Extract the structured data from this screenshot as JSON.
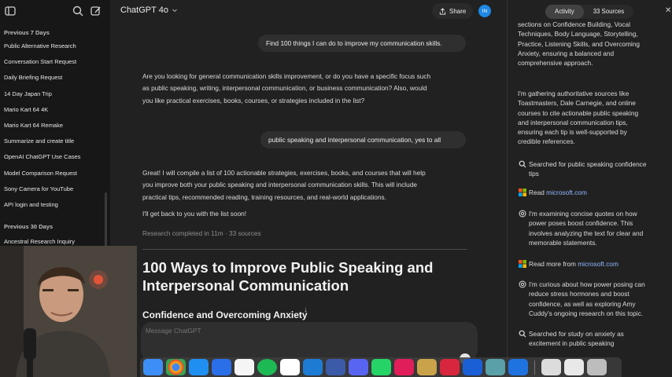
{
  "header": {
    "model_title": "ChatGPT 4o",
    "share_label": "Share",
    "avatar_initials": "IN"
  },
  "sidebar": {
    "sections": [
      {
        "label": "Previous 7 Days",
        "items": [
          "Public Alternative Research",
          "Conversation Start Request",
          "Daily Briefing Request",
          "14 Day Japan Trip",
          "Mario Kart 64 4K",
          "Mario Kart 64 Remake",
          "Summarize and create title",
          "OpenAI ChatGPT Use Cases",
          "Model Comparison Request",
          "Sony Camera for YouTube",
          "API login and testing"
        ]
      },
      {
        "label": "Previous 30 Days",
        "items": [
          "Ancestral Research Inquiry"
        ]
      }
    ]
  },
  "chat": {
    "user_msg_1": "Find 100 things I can do to improve my communication skills.",
    "assistant_msg_1": [
      "Are you looking for general communication skills improvement, or do you have a specific focus such",
      "as public speaking, writing, interpersonal communication, or business communication? Also, would",
      "you like practical exercises, books, courses, or strategies included in the list?"
    ],
    "user_msg_2": "public speaking and interpersonal communication, yes to all",
    "assistant_msg_2": [
      "Great! I will compile a list of 100 actionable strategies, exercises, books, and courses that will help",
      "you improve both your public speaking and interpersonal communication skills. This will include",
      "practical tips, recommended reading, training resources, and real-world applications."
    ],
    "assistant_msg_3": "I'll get back to you with the list soon!",
    "research_status": "Research completed in 11m · 33 sources",
    "report_title": "100 Ways to Improve Public Speaking and Interpersonal Communication",
    "report_subtitle": "Confidence and Overcoming Anxiety",
    "composer_placeholder": "Message ChatGPT"
  },
  "activity_panel": {
    "tab_activity": "Activity",
    "tab_sources": "33 Sources",
    "items": [
      {
        "kind": "text",
        "lines": [
          "sections on Confidence Building, Vocal",
          "Techniques, Body Language, Storytelling,",
          "Practice, Listening Skills, and Overcoming",
          "Anxiety, ensuring a balanced and",
          "comprehensive approach."
        ]
      },
      {
        "kind": "text",
        "lines": [
          "I'm gathering authoritative sources like",
          "Toastmasters, Dale Carnegie, and online",
          "courses to cite actionable public speaking",
          "and interpersonal communication tips,",
          "ensuring each tip is well-supported by",
          "credible references."
        ]
      },
      {
        "kind": "search",
        "lines": [
          "Searched for public speaking confidence",
          "tips"
        ]
      },
      {
        "kind": "read",
        "prefix": "Read",
        "link": "microsoft.com"
      },
      {
        "kind": "thought",
        "lines": [
          "I'm examining concise quotes on how",
          "power poses boost confidence. This",
          "involves analyzing the text for clear and",
          "memorable statements."
        ]
      },
      {
        "kind": "read",
        "prefix": "Read more from",
        "link": "microsoft.com"
      },
      {
        "kind": "thought",
        "lines": [
          "I'm curious about how power posing can",
          "reduce stress hormones and boost",
          "confidence, as well as exploring Amy",
          "Cuddy's ongoing research on this topic."
        ]
      },
      {
        "kind": "search",
        "lines": [
          "Searched for study on anxiety as",
          "excitement in public speaking"
        ]
      }
    ]
  },
  "icons": {
    "sidebar_toggle": "sidebar-toggle-icon",
    "search": "search-icon",
    "new_chat": "new-chat-icon",
    "chevron": "chevron-down-icon",
    "share": "share-icon",
    "close": "close-icon",
    "search_step": "search-icon",
    "read_step": "microsoft-logo-icon",
    "thought_step": "openai-logo-icon",
    "scroll_down": "arrow-down-icon"
  },
  "colors": {
    "background": "#212121",
    "sidebar": "#171717",
    "bubble": "#2f2f2f",
    "link": "#8fb8ff",
    "avatar": "#1e88e5"
  }
}
